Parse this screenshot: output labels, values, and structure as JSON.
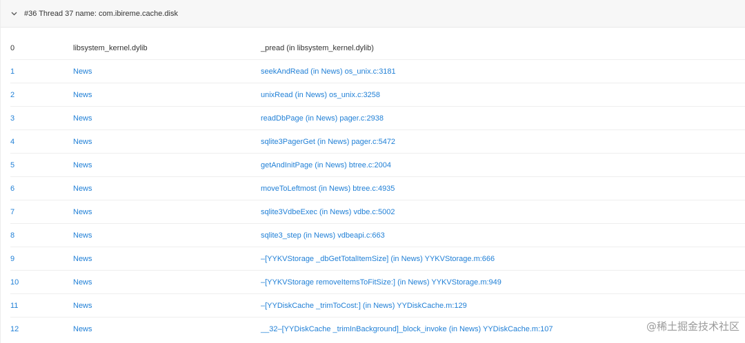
{
  "thread": {
    "title": "#36 Thread 37 name: com.ibireme.cache.disk"
  },
  "frames": [
    {
      "idx": "0",
      "lib": "libsystem_kernel.dylib",
      "sym": "_pread (in libsystem_kernel.dylib)",
      "linked": false
    },
    {
      "idx": "1",
      "lib": "News",
      "sym": "seekAndRead (in News) os_unix.c:3181",
      "linked": true
    },
    {
      "idx": "2",
      "lib": "News",
      "sym": "unixRead (in News) os_unix.c:3258",
      "linked": true
    },
    {
      "idx": "3",
      "lib": "News",
      "sym": "readDbPage (in News) pager.c:2938",
      "linked": true
    },
    {
      "idx": "4",
      "lib": "News",
      "sym": "sqlite3PagerGet (in News) pager.c:5472",
      "linked": true
    },
    {
      "idx": "5",
      "lib": "News",
      "sym": "getAndInitPage (in News) btree.c:2004",
      "linked": true
    },
    {
      "idx": "6",
      "lib": "News",
      "sym": "moveToLeftmost (in News) btree.c:4935",
      "linked": true
    },
    {
      "idx": "7",
      "lib": "News",
      "sym": "sqlite3VdbeExec (in News) vdbe.c:5002",
      "linked": true
    },
    {
      "idx": "8",
      "lib": "News",
      "sym": "sqlite3_step (in News) vdbeapi.c:663",
      "linked": true
    },
    {
      "idx": "9",
      "lib": "News",
      "sym": "–[YYKVStorage _dbGetTotalItemSize] (in News) YYKVStorage.m:666",
      "linked": true
    },
    {
      "idx": "10",
      "lib": "News",
      "sym": "–[YYKVStorage removeItemsToFitSize:] (in News) YYKVStorage.m:949",
      "linked": true
    },
    {
      "idx": "11",
      "lib": "News",
      "sym": "–[YYDiskCache _trimToCost:] (in News) YYDiskCache.m:129",
      "linked": true
    },
    {
      "idx": "12",
      "lib": "News",
      "sym": "__32–[YYDiskCache _trimInBackground]_block_invoke (in News) YYDiskCache.m:107",
      "linked": true
    }
  ],
  "watermark": "@稀土掘金技术社区",
  "colors": {
    "link": "#1f7fd6",
    "text": "#333333",
    "header_bg": "#f7f7f7"
  },
  "icons": {
    "collapse": "chevron-down-icon"
  }
}
